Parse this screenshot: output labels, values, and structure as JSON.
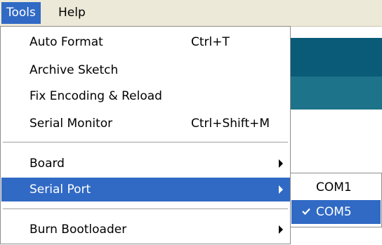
{
  "menubar": {
    "items": [
      "Tools",
      "Help"
    ]
  },
  "tools_menu": {
    "items": [
      {
        "label": "Auto Format",
        "shortcut": "Ctrl+T"
      },
      {
        "label": "Archive Sketch",
        "shortcut": ""
      },
      {
        "label": "Fix Encoding & Reload",
        "shortcut": ""
      },
      {
        "label": "Serial Monitor",
        "shortcut": "Ctrl+Shift+M"
      },
      {
        "label": "Board",
        "shortcut": ""
      },
      {
        "label": "Serial Port",
        "shortcut": ""
      },
      {
        "label": "Burn Bootloader",
        "shortcut": ""
      }
    ]
  },
  "serial_port_submenu": {
    "items": [
      {
        "label": "COM1",
        "checked": false
      },
      {
        "label": "COM5",
        "checked": true
      }
    ]
  },
  "colors": {
    "highlight": "#316ac5",
    "menubar_bg": "#ece9d8",
    "editor_band_dark": "#095b77",
    "editor_band_mid": "#1d7389"
  }
}
